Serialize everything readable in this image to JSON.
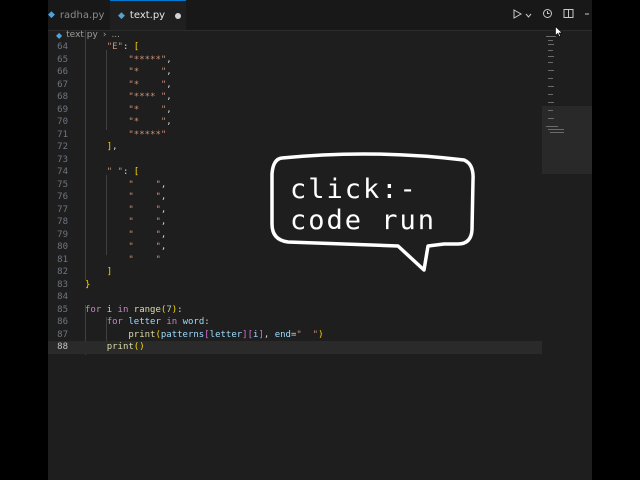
{
  "tabs": [
    {
      "label": "radha.py",
      "active": false,
      "modified": false
    },
    {
      "label": "text.py",
      "active": true,
      "modified": true
    }
  ],
  "breadcrumb": [
    "text.py",
    "..."
  ],
  "callout": {
    "line1": "click:-",
    "line2": "code run"
  },
  "code": {
    "current_line": "88",
    "lines": [
      {
        "n": "64",
        "t": "    \"E\": ["
      },
      {
        "n": "65",
        "t": "        \"*****\","
      },
      {
        "n": "66",
        "t": "        \"*    \","
      },
      {
        "n": "67",
        "t": "        \"*    \","
      },
      {
        "n": "68",
        "t": "        \"**** \","
      },
      {
        "n": "69",
        "t": "        \"*    \","
      },
      {
        "n": "70",
        "t": "        \"*    \","
      },
      {
        "n": "71",
        "t": "        \"*****\""
      },
      {
        "n": "72",
        "t": "    ],"
      },
      {
        "n": "73",
        "t": ""
      },
      {
        "n": "74",
        "t": "    \" \": ["
      },
      {
        "n": "75",
        "t": "        \"    \","
      },
      {
        "n": "76",
        "t": "        \"    \","
      },
      {
        "n": "77",
        "t": "        \"    \","
      },
      {
        "n": "78",
        "t": "        \"    \","
      },
      {
        "n": "79",
        "t": "        \"    \","
      },
      {
        "n": "80",
        "t": "        \"    \","
      },
      {
        "n": "81",
        "t": "        \"    \""
      },
      {
        "n": "82",
        "t": "    ]"
      },
      {
        "n": "83",
        "t": "}"
      },
      {
        "n": "84",
        "t": ""
      },
      {
        "n": "85",
        "t": "for i in range(7):"
      },
      {
        "n": "86",
        "t": "    for letter in word:"
      },
      {
        "n": "87",
        "t": "        print(patterns[letter][i], end=\"  \")"
      },
      {
        "n": "88",
        "t": "    print()"
      }
    ]
  },
  "icons": {
    "file": "python-file-icon",
    "run": "run-icon",
    "run_dropdown": "chevron-down-icon",
    "history": "history-icon",
    "split": "split-editor-icon",
    "more": "more-icon",
    "pointer": "mouse-pointer-icon"
  },
  "colors": {
    "editor_bg": "#1e1e1e",
    "tabbar_bg": "#181818",
    "keyword": "#c586c0",
    "function": "#dcdcaa",
    "variable": "#9cdcfe",
    "string": "#ce9178",
    "number": "#b5cea8",
    "line_number": "#6e7681"
  }
}
